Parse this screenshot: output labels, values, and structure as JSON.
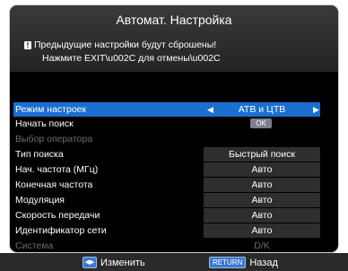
{
  "dialog": {
    "title": "Автомат. Настройка",
    "warning_line1": "Предыдущие настройки будут сброшены!",
    "warning_line2": "Нажмите EXIT\\u002C  для отмены\\u002C"
  },
  "settings": {
    "mode": {
      "label": "Режим настроек",
      "value": "АТВ и ЦТВ"
    },
    "start_search": {
      "label": "Начать поиск",
      "button": "OK"
    },
    "operator": {
      "label": "Выбор оператора"
    },
    "search_type": {
      "label": "Тип поиска",
      "value": "Быстрый поиск"
    },
    "start_freq": {
      "label": "Нач. частота (МГц)",
      "value": "Авто"
    },
    "end_freq": {
      "label": "Конечная частота",
      "value": "Авто"
    },
    "modulation": {
      "label": "Модуляция",
      "value": "Авто"
    },
    "symbol_rate": {
      "label": "Скорость передачи",
      "value": "Авто"
    },
    "network_id": {
      "label": "Идентификатор сети",
      "value": "Авто"
    },
    "system": {
      "label": "Система",
      "value": "D/K"
    }
  },
  "footer": {
    "change_label": "Изменить",
    "return_key": "RETURN",
    "back_label": "Назад"
  },
  "colors": {
    "selection": "#1a6fd0",
    "panel": "#000000",
    "header": "#2c2c2c",
    "disabled_text": "#6d6d6d"
  }
}
